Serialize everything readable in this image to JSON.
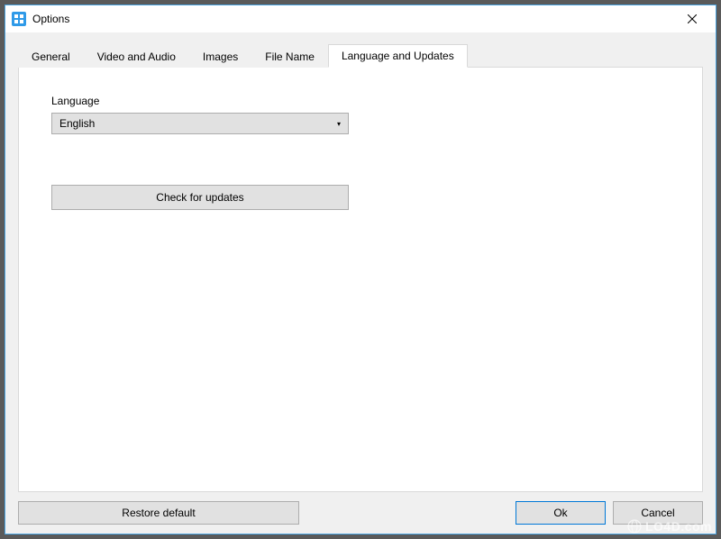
{
  "window": {
    "title": "Options"
  },
  "tabs": [
    {
      "label": "General"
    },
    {
      "label": "Video and Audio"
    },
    {
      "label": "Images"
    },
    {
      "label": "File Name"
    },
    {
      "label": "Language and Updates"
    }
  ],
  "active_tab_index": 4,
  "language": {
    "label": "Language",
    "value": "English"
  },
  "buttons": {
    "check_updates": "Check for updates",
    "restore_default": "Restore default",
    "ok": "Ok",
    "cancel": "Cancel"
  },
  "watermark": "LO4D.com"
}
